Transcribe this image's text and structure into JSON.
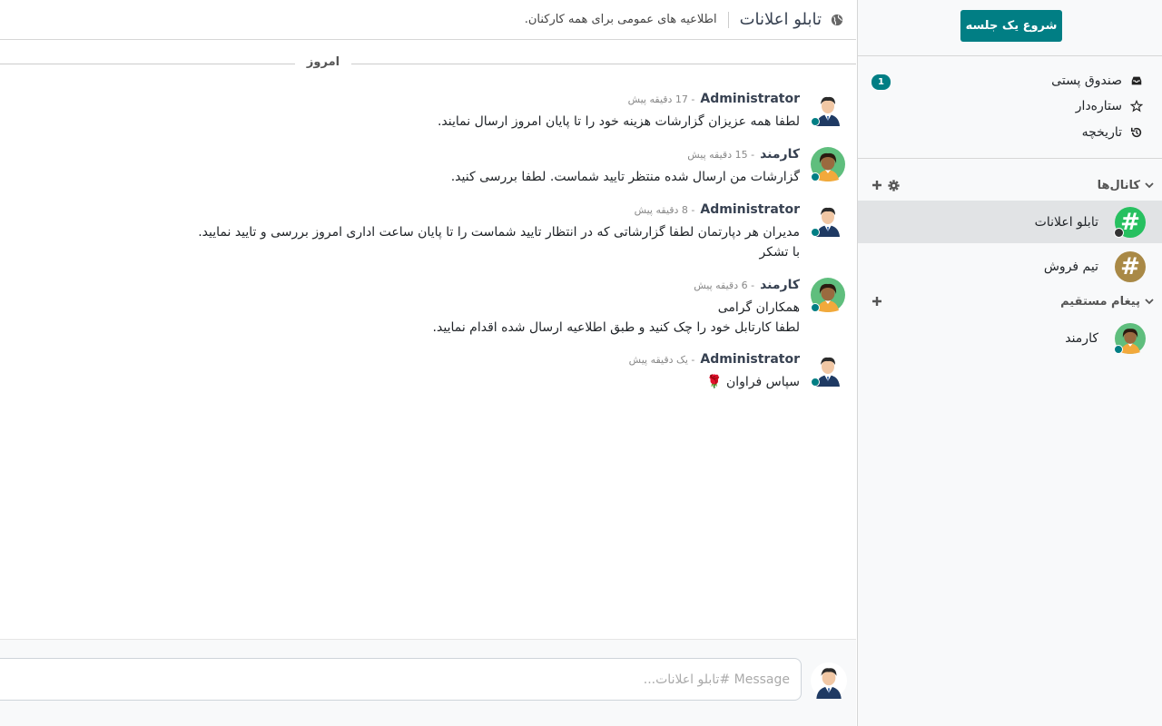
{
  "sidebar": {
    "start_button": "شروع یک جلسه",
    "mailboxes": [
      {
        "label": "صندوق پستی",
        "icon": "inbox-icon",
        "badge": "1"
      },
      {
        "label": "ستاره‌دار",
        "icon": "star-icon"
      },
      {
        "label": "تاریخچه",
        "icon": "history-icon"
      }
    ],
    "channels_category": "کانال‌ها",
    "channels": [
      {
        "label": "تابلو اعلانات",
        "color": "#27c060",
        "active": true
      },
      {
        "label": "تیم فروش",
        "color": "#a98946"
      }
    ],
    "dm_category": "پیغام مستقیم",
    "direct_messages": [
      {
        "label": "کارمند"
      }
    ]
  },
  "header": {
    "title": "تابلو اعلانات",
    "description": "اطلاعیه های عمومی برای همه کارکنان."
  },
  "date_separator": "امروز",
  "messages": [
    {
      "author": "Administrator",
      "time": "- 17 دقیقه پیش",
      "lines": [
        "لطفا همه عزیزان گزارشات هزینه خود را تا پایان امروز ارسال نمایند."
      ]
    },
    {
      "author": "کارمند",
      "time": "- 15 دقیقه پیش",
      "lines": [
        "گزارشات من ارسال شده منتظر تایید شماست. لطفا بررسی کنید."
      ]
    },
    {
      "author": "Administrator",
      "time": "- 8 دقیقه پیش",
      "lines": [
        "مدیران هر دپارتمان لطفا گزارشاتی که در انتظار تایید شماست را تا پایان ساعت اداری امروز بررسی و تایید نمایید.",
        "با تشکر"
      ]
    },
    {
      "author": "کارمند",
      "time": "- 6 دقیقه پیش",
      "lines": [
        "همکاران گرامی",
        "لطفا کارتابل خود را چک کنید و طبق اطلاعیه ارسال شده اقدام نمایید."
      ]
    },
    {
      "author": "Administrator",
      "time": "- یک دقیقه پیش",
      "lines": [
        "سپاس فراوان 🌹"
      ]
    }
  ],
  "composer": {
    "placeholder": "Message #تابلو اعلانات..."
  },
  "colors": {
    "accent": "#017e84",
    "active_row": "#e1e3e5"
  }
}
